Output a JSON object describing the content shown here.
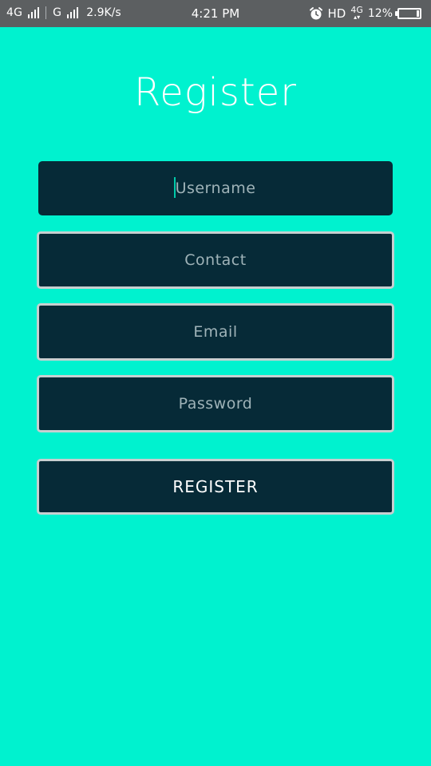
{
  "status_bar": {
    "network_1": "4G",
    "network_2": "G",
    "speed": "2.9K/s",
    "time": "4:21 PM",
    "hd": "HD",
    "net_4g": "4G",
    "battery_percent": "12%",
    "battery_level": 0.12
  },
  "page": {
    "title": "Register"
  },
  "form": {
    "username_placeholder": "Username",
    "contact_placeholder": "Contact",
    "email_placeholder": "Email",
    "password_placeholder": "Password",
    "register_button": "REGISTER"
  },
  "colors": {
    "background": "#00F2CF",
    "field_background": "#062A37",
    "field_border": "#C7CFD0",
    "status_bar": "#5C5F61"
  }
}
